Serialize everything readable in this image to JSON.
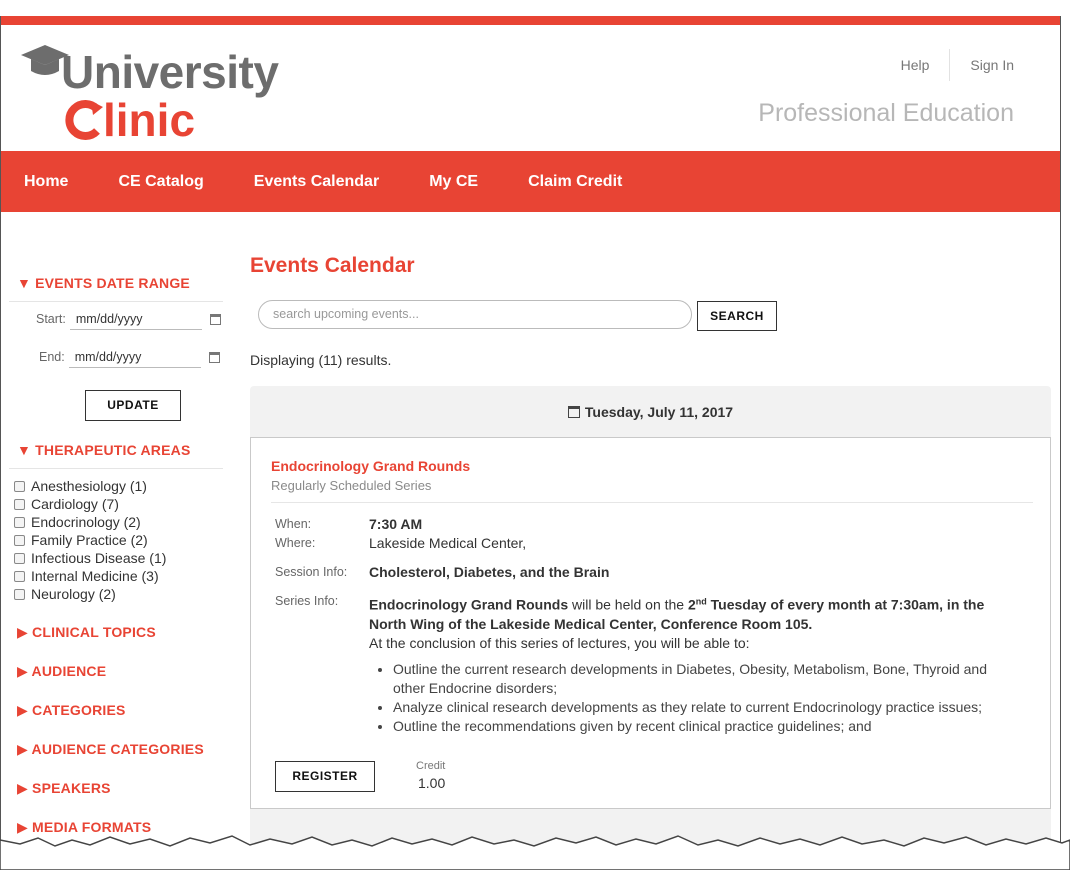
{
  "header": {
    "logo_top": "University",
    "logo_bottom": "linic",
    "help": "Help",
    "sign_in": "Sign In",
    "tagline": "Professional Education"
  },
  "nav": {
    "items": [
      "Home",
      "CE Catalog",
      "Events Calendar",
      "My CE",
      "Claim Credit"
    ]
  },
  "sidebar": {
    "date_range": {
      "heading": "▼ EVENTS DATE RANGE",
      "start_label": "Start:",
      "start_placeholder": "mm/dd/yyyy",
      "end_label": "End:",
      "end_placeholder": "mm/dd/yyyy",
      "update": "UPDATE"
    },
    "therapeutic": {
      "heading": "▼ THERAPEUTIC AREAS",
      "items": [
        "Anesthesiology (1)",
        "Cardiology (7)",
        "Endocrinology (2)",
        "Family Practice (2)",
        "Infectious Disease (1)",
        "Internal Medicine (3)",
        "Neurology (2)"
      ]
    },
    "collapsed": [
      "▶ CLINICAL TOPICS",
      "▶ AUDIENCE",
      "▶ CATEGORIES",
      "▶ AUDIENCE CATEGORIES",
      "▶ SPEAKERS",
      "▶ MEDIA FORMATS"
    ]
  },
  "main": {
    "title": "Events Calendar",
    "search_placeholder": "search upcoming events...",
    "search_btn": "SEARCH",
    "results": "Displaying (11) results.",
    "day": "Tuesday, July 11, 2017",
    "event": {
      "title": "Endocrinology Grand Rounds",
      "subtitle": "Regularly Scheduled Series",
      "when_label": "When:",
      "when": "7:30 AM",
      "where_label": "Where:",
      "where": "Lakeside Medical Center,",
      "session_label": "Session Info:",
      "session": "Cholesterol, Diabetes, and the Brain",
      "series_label": "Series Info:",
      "series_name": "Endocrinology Grand Rounds",
      "series_mid": " will be held on the ",
      "series_ord": "2",
      "series_sup": "nd",
      "series_bold": " Tuesday of every month at 7:30am, in the North Wing of the Lakeside Medical Center, Conference Room 105.",
      "series_intro": "At the conclusion of this series of lectures, you will be able to:",
      "bullets": [
        "Outline the current research developments in Diabetes, Obesity, Metabolism, Bone, Thyroid and other Endocrine disorders;",
        "Analyze clinical research developments as they relate to current Endocrinology practice issues;",
        "Outline the recommendations given by recent clinical practice guidelines; and"
      ],
      "register": "REGISTER",
      "credit_label": "Credit",
      "credit_value": "1.00"
    }
  },
  "colors": {
    "brand_red": "#e84434",
    "logo_gray": "#6d6d6d"
  }
}
